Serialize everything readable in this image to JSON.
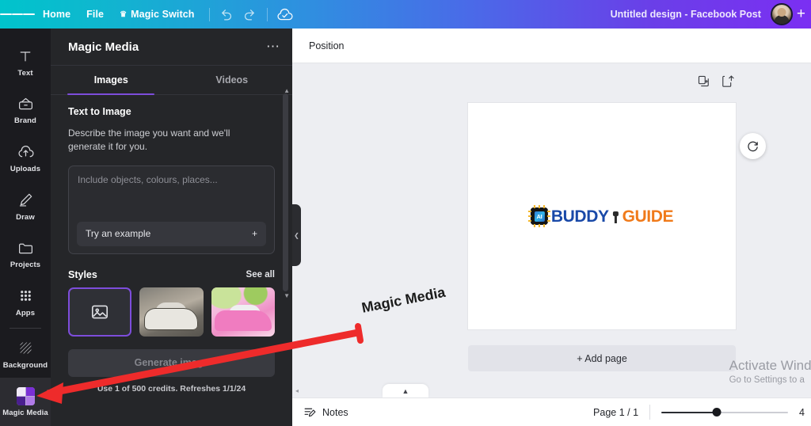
{
  "header": {
    "menu_icon": "hamburger-icon",
    "items": [
      {
        "label": "Home",
        "name": "home"
      },
      {
        "label": "File",
        "name": "file"
      },
      {
        "label": "Magic Switch",
        "name": "magic-switch",
        "crown": "♛"
      }
    ],
    "undo_icon": "undo-icon",
    "redo_icon": "redo-icon",
    "cloud_icon": "cloud-saved-icon",
    "doc_title": "Untitled design - Facebook Post",
    "add_icon": "plus-icon",
    "avatar": "user-avatar"
  },
  "sidebar": {
    "items": [
      {
        "label": "Text",
        "icon": "text-icon"
      },
      {
        "label": "Brand",
        "icon": "brand-icon"
      },
      {
        "label": "Uploads",
        "icon": "uploads-icon"
      },
      {
        "label": "Draw",
        "icon": "draw-icon"
      },
      {
        "label": "Projects",
        "icon": "projects-folder-icon"
      },
      {
        "label": "Apps",
        "icon": "apps-grid-icon"
      },
      {
        "label": "Background",
        "icon": "background-icon"
      },
      {
        "label": "Magic Media",
        "icon": "magic-media-icon",
        "active": true
      }
    ]
  },
  "panel": {
    "title": "Magic Media",
    "overflow_icon": "more-options-icon",
    "tabs": [
      {
        "label": "Images",
        "active": true
      },
      {
        "label": "Videos",
        "active": false
      }
    ],
    "section_title": "Text to Image",
    "description": "Describe the image you want and we'll generate it for you.",
    "prompt_placeholder": "Include objects, colours, places...",
    "try_example_label": "Try an example",
    "try_example_icon": "plus-icon",
    "styles_label": "Styles",
    "see_all_label": "See all",
    "styles": [
      {
        "name": "no-style-placeholder",
        "icon": "image-placeholder-icon",
        "selected": true
      },
      {
        "name": "vintage-car-style",
        "selected": false
      },
      {
        "name": "watercolour-car-style",
        "selected": false
      }
    ],
    "generate_label": "Generate image",
    "credits_note": "Use 1 of 500 credits. Refreshes 1/1/24",
    "collapse_icon": "chevron-left-icon",
    "scroll_up_icon": "▲",
    "scroll_down_icon": "▼"
  },
  "canvas": {
    "position_label": "Position",
    "duplicate_icon": "duplicate-page-icon",
    "export_icon": "export-page-icon",
    "refresh_icon": "regenerate-icon",
    "add_page_label": "+ Add page",
    "logo": {
      "badge_text": "AI",
      "word1": "BUDDY",
      "word2": "GUIDE",
      "blue": "#1949a8",
      "orange": "#f07a1a"
    }
  },
  "bottom": {
    "notes_label": "Notes",
    "notes_icon": "notes-icon",
    "page_indicator": "Page 1 / 1",
    "zoom_value": "4",
    "expander_icon": "chevron-up-icon",
    "scroll_left_icon": "◂"
  },
  "watermark": {
    "line1": "Activate Windo",
    "line2": "Go to Settings to a"
  },
  "annotation": {
    "label": "Magic Media",
    "arrow_color": "#ee2b2b"
  }
}
